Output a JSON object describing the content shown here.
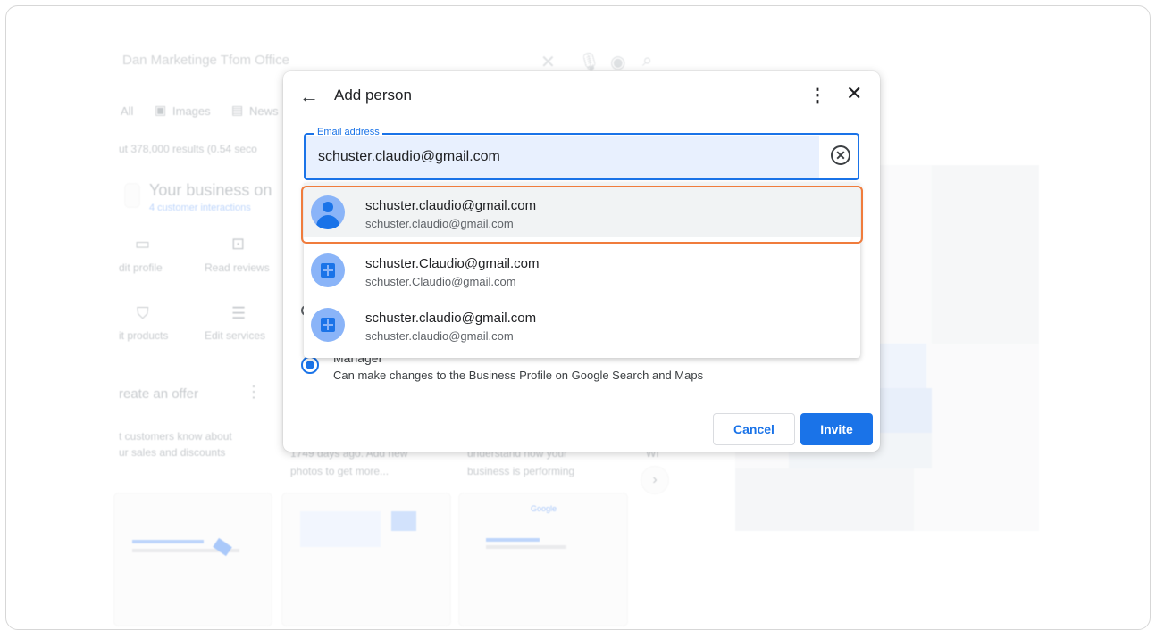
{
  "background": {
    "search_query": "Dan Marketinge Tfom Office",
    "tabs": [
      "All",
      "Images",
      "News"
    ],
    "results_count": "ut 378,000 results (0.54 seco",
    "business_title": "Your business on",
    "customer_interactions": "4 customer interactions",
    "actions": [
      "dit profile",
      "Read reviews",
      "it products",
      "Edit services"
    ],
    "offer_title": "reate an offer",
    "offer_text_1": "t customers know about",
    "offer_text_2": "ur sales and discounts",
    "card_1_line_1": "1749 days ago. Add new",
    "card_1_line_2": "photos to get more...",
    "card_2_line_1": "understand how your",
    "card_2_line_2": "business is performing",
    "card_3_text": "WI",
    "card_2_brand": "Google"
  },
  "dialog": {
    "title": "Add person",
    "email_label": "Email address",
    "email_value": "schuster.claudio@gmail.com",
    "role_title": "Manager",
    "role_description": "Can make changes to the Business Profile on Google Search and Maps",
    "cancel_label": "Cancel",
    "invite_label": "Invite"
  },
  "suggestions": [
    {
      "primary": "schuster.claudio@gmail.com",
      "secondary": "schuster.claudio@gmail.com",
      "avatar": "person-icon",
      "highlighted": true
    },
    {
      "primary": "schuster.Claudio@gmail.com",
      "secondary": "schuster.Claudio@gmail.com",
      "avatar": "group-icon",
      "highlighted": false
    },
    {
      "primary": "schuster.claudio@gmail.com",
      "secondary": "schuster.claudio@gmail.com",
      "avatar": "group-icon",
      "highlighted": false
    }
  ],
  "colors": {
    "accent": "#1a73e8",
    "highlight_outline": "#f07c3c"
  }
}
